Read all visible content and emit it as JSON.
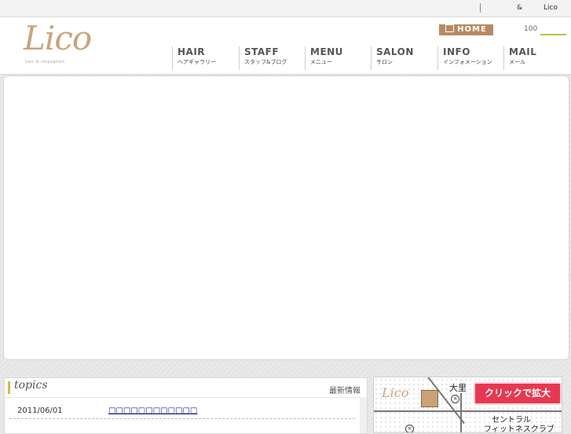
{
  "topbar": {
    "separator": "|",
    "amp": "&",
    "brand": "Lico"
  },
  "header": {
    "logo": {
      "script": "Lico",
      "subtitle": "hair & relaxation"
    },
    "home_label": "HOME",
    "font_size": "100"
  },
  "nav": [
    {
      "en": "HAIR",
      "ja": "ヘアギャラリー"
    },
    {
      "en": "STAFF",
      "ja": "スタッフ&ブログ"
    },
    {
      "en": "MENU",
      "ja": "メニュー"
    },
    {
      "en": "SALON",
      "ja": "サロン"
    },
    {
      "en": "INFO",
      "ja": "インフォメーション"
    },
    {
      "en": "MAIL",
      "ja": "メール"
    }
  ],
  "topics": {
    "title": "topics",
    "latest_label": "最新情報",
    "items": [
      {
        "date": "2011/06/01",
        "text": "□□□□□□□□□□□□"
      }
    ]
  },
  "map": {
    "logo": "Lico",
    "station": "大里",
    "landmark_line1": "セントラル",
    "landmark_line2": "フィットネスクラブ",
    "zoom_button": "クリックで拡大"
  },
  "colors": {
    "accent": "#b98a63",
    "logo": "#c8a57d",
    "zoom_button": "#e63950",
    "link": "#1a1a8c"
  }
}
